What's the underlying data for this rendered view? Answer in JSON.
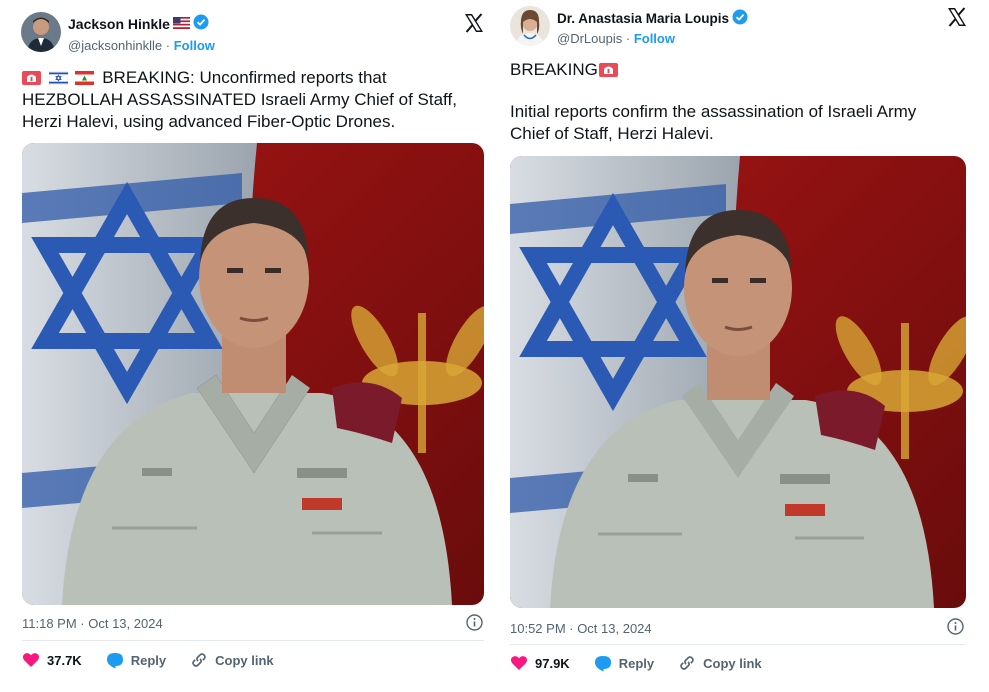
{
  "tweets": [
    {
      "author": "Jackson Hinkle",
      "name_flag": "🇺🇸",
      "handle": "@jacksonhinklle",
      "follow_label": "Follow",
      "lead_emojis": [
        "🚨",
        "🇮🇱",
        "🇱🇧"
      ],
      "text_lines": [
        "BREAKING: Unconfirmed reports that",
        "HEZBOLLAH ASSASSINATED Israeli Army Chief of Staff,",
        "Herzi Halevi, using advanced Fiber-Optic Drones."
      ],
      "timestamp": "11:18 PM · Oct 13, 2024",
      "likes": "37.7K",
      "reply_label": "Reply",
      "copy_label": "Copy link"
    },
    {
      "author": "Dr. Anastasia Maria Loupis",
      "handle": "@DrLoupis",
      "follow_label": "Follow",
      "breaking_text": "BREAKING",
      "text_lines": [
        "Initial reports confirm the assassination of Israeli Army",
        "Chief of Staff, Herzi Halevi."
      ],
      "timestamp": "10:52 PM · Oct 13, 2024",
      "likes": "97.9K",
      "reply_label": "Reply",
      "copy_label": "Copy link"
    }
  ],
  "colors": {
    "follow": "#1d9bf0",
    "verified": "#1d9bf0",
    "like": "#f91880",
    "reply": "#1d9bf0",
    "muted": "#536471"
  },
  "separator": "·"
}
